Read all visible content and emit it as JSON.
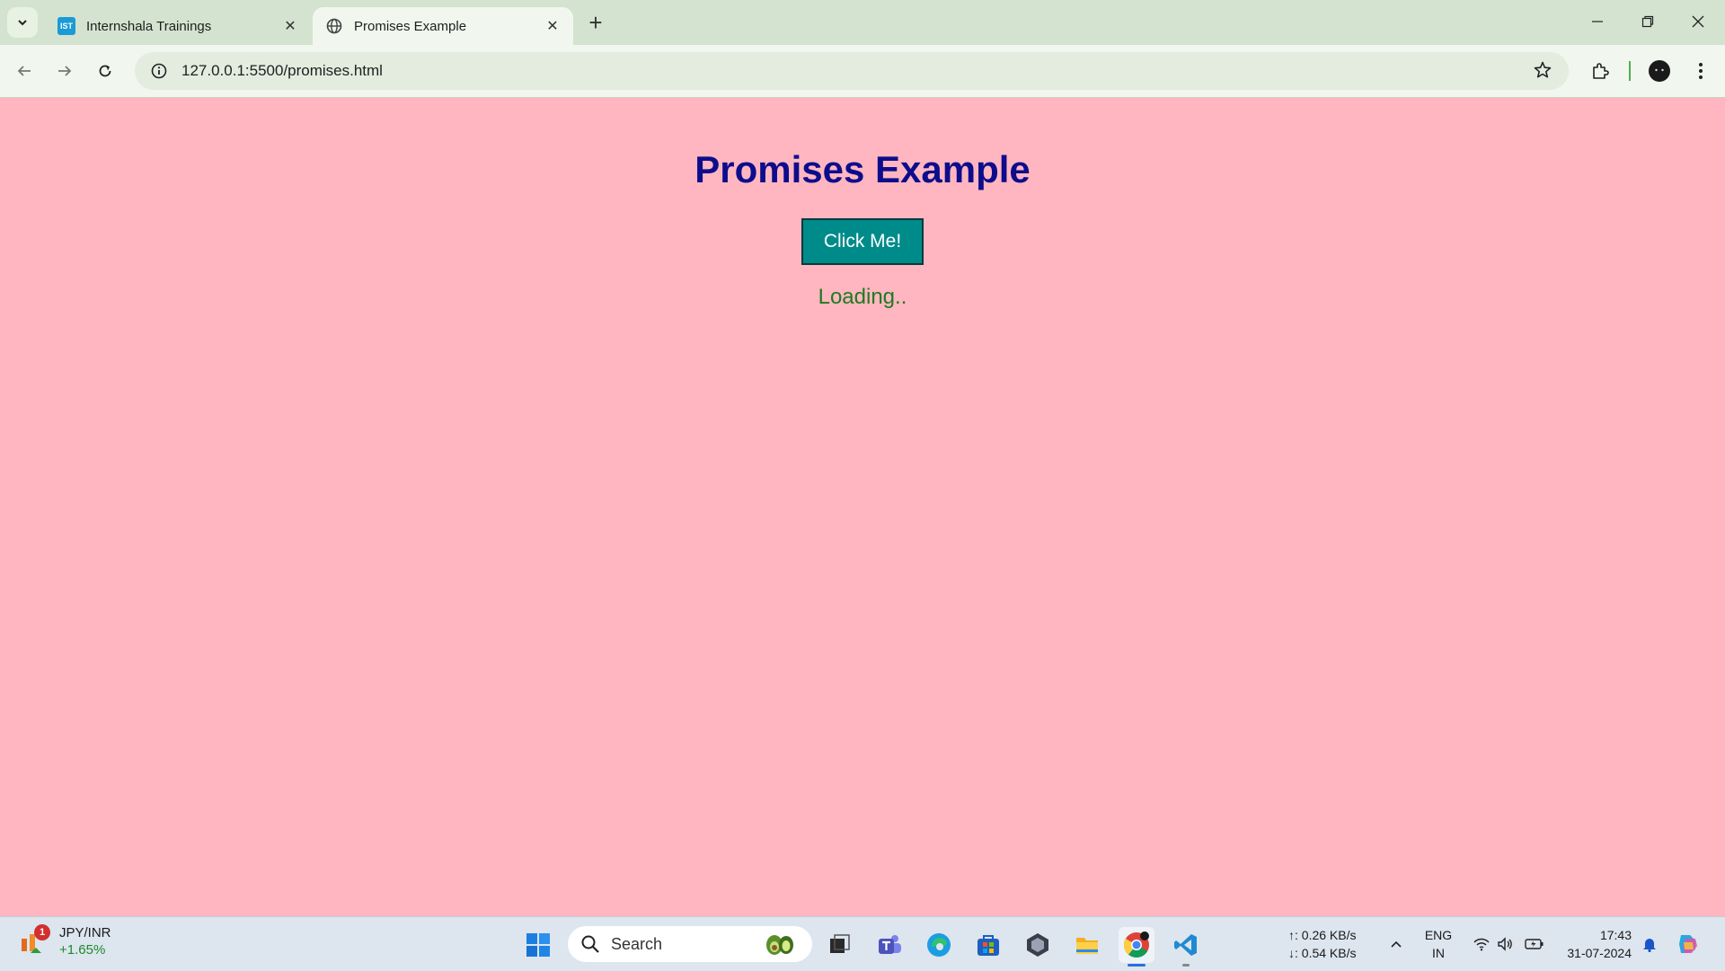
{
  "browser": {
    "tabs": [
      {
        "title": "Internshala Trainings",
        "favicon": "ist-icon",
        "favicon_text": "IST",
        "active": false
      },
      {
        "title": "Promises Example",
        "favicon": "globe-icon",
        "active": true
      }
    ],
    "url": "127.0.0.1:5500/promises.html"
  },
  "page": {
    "heading": "Promises Example",
    "button_label": "Click Me!",
    "status_text": "Loading..",
    "colors": {
      "background": "#ffb6c1",
      "heading": "#0d0d8c",
      "button": "#008b8b",
      "status": "#1f7a1f"
    }
  },
  "taskbar": {
    "widget": {
      "symbol": "JPY/INR",
      "change": "+1.65%",
      "badge": "1"
    },
    "search_placeholder": "Search",
    "apps": [
      "start-icon",
      "task-view-icon",
      "teams-icon",
      "edge-icon",
      "store-icon",
      "app-icon",
      "file-explorer-icon",
      "chrome-icon",
      "vscode-icon"
    ],
    "network": {
      "up": "↑: 0.26 KB/s",
      "down": "↓: 0.54 KB/s"
    },
    "language": {
      "line1": "ENG",
      "line2": "IN"
    },
    "clock": {
      "time": "17:43",
      "date": "31-07-2024"
    }
  }
}
